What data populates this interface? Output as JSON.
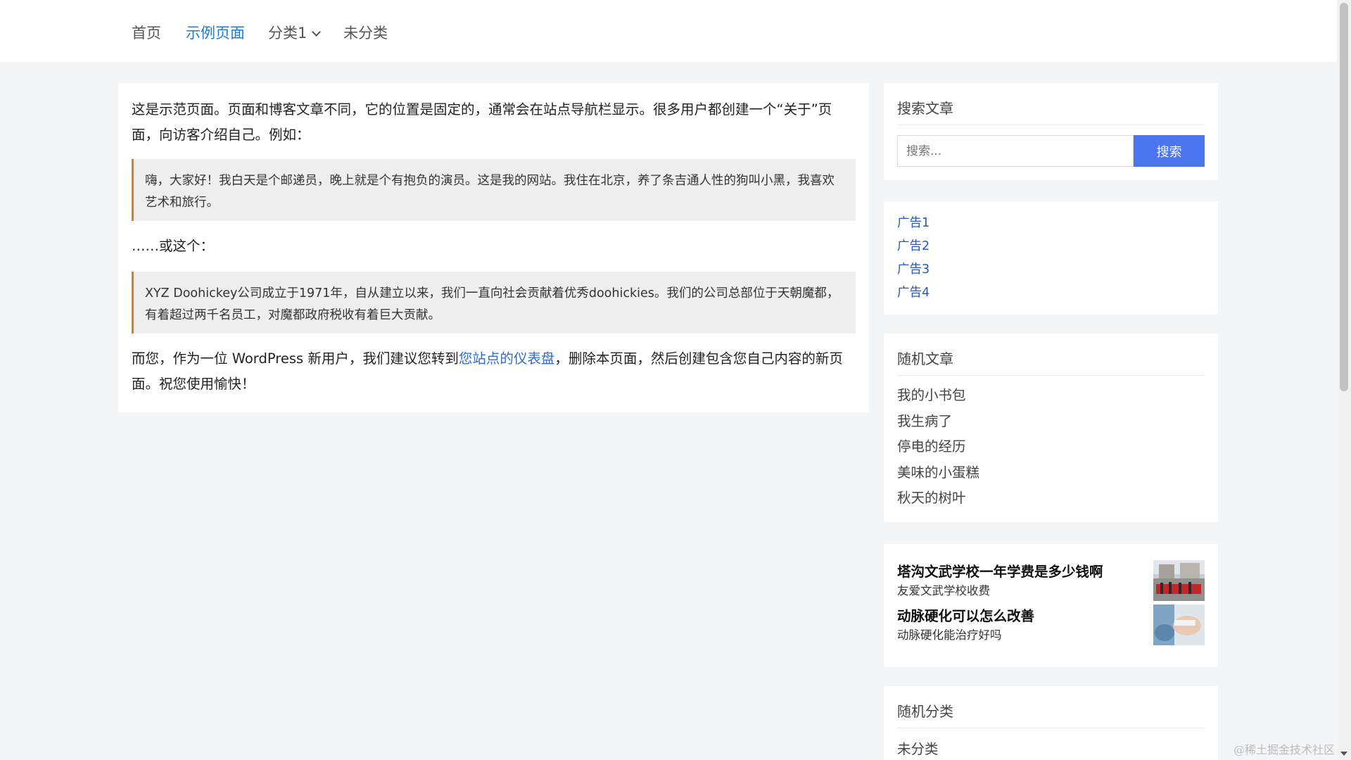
{
  "nav": {
    "items": [
      {
        "label": "首页"
      },
      {
        "label": "示例页面"
      },
      {
        "label": "分类1"
      },
      {
        "label": "未分类"
      }
    ],
    "accent_color": "#1f7bd6"
  },
  "article": {
    "intro": "这是示范页面。页面和博客文章不同，它的位置是固定的，通常会在站点导航栏显示。很多用户都创建一个“关于”页面，向访客介绍自己。例如：",
    "quote1": "嗨，大家好！我白天是个邮递员，晚上就是个有抱负的演员。这是我的网站。我住在北京，养了条吉通人性的狗叫小黑，我喜欢艺术和旅行。",
    "or_this": "……或这个：",
    "quote2": "XYZ Doohickey公司成立于1971年，自从建立以来，我们一直向社会贡献着优秀doohickies。我们的公司总部位于天朝魔都，有着超过两千名员工，对魔都政府税收有着巨大贡献。",
    "outro_before": "而您，作为一位 WordPress 新用户，我们建议您转到",
    "outro_link": "您站点的仪表盘",
    "outro_after": "，删除本页面，然后创建包含您自己内容的新页面。祝您使用愉快！",
    "quote_border_color": "#e07b2a",
    "link_color": "#2f6bd0"
  },
  "sidebar": {
    "search": {
      "title": "搜索文章",
      "placeholder": "搜索...",
      "button_label": "搜索",
      "button_color": "#4a74f0"
    },
    "ads": [
      "广告1",
      "广告2",
      "广告3",
      "广告4"
    ],
    "random_posts": {
      "title": "随机文章",
      "items": [
        "我的小书包",
        "我生病了",
        "停电的经历",
        "美味的小蛋糕",
        "秋天的树叶"
      ]
    },
    "promos": [
      {
        "title": "塔沟文武学校一年学费是多少钱啊",
        "subtitle": "友爱文武学校收费"
      },
      {
        "title": "动脉硬化可以怎么改善",
        "subtitle": "动脉硬化能治疗好吗"
      }
    ],
    "random_categories": {
      "title": "随机分类",
      "items": [
        "未分类"
      ]
    }
  },
  "watermark": "@稀土掘金技术社区"
}
